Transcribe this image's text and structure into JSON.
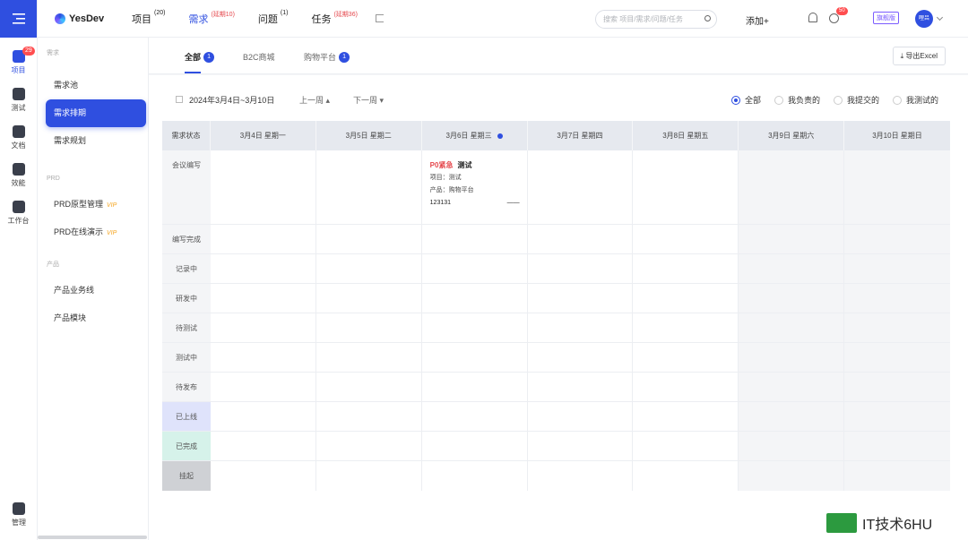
{
  "rail": {
    "items": [
      {
        "label": "项目",
        "badge": "29",
        "icon": "project-icon"
      },
      {
        "label": "测试",
        "icon": "test-icon"
      },
      {
        "label": "文档",
        "icon": "doc-icon"
      },
      {
        "label": "效能",
        "icon": "performance-icon"
      },
      {
        "label": "工作台",
        "icon": "workbench-icon"
      }
    ],
    "bottom_label": "管理"
  },
  "topbar": {
    "logo": "YesDev",
    "nav": [
      {
        "label": "项目",
        "count": "(20)",
        "count_red": false
      },
      {
        "label": "需求",
        "count": "(延期10)",
        "count_red": true
      },
      {
        "label": "问题",
        "count": "(1)",
        "count_red": false
      },
      {
        "label": "任务",
        "count": "(延期36)",
        "count_red": true
      }
    ],
    "search_placeholder": "搜索 项目/需求/问题/任务",
    "add_label": "添加+",
    "clock_badge": "50",
    "edition": "旗舰版",
    "avatar_text": "哩吕"
  },
  "sidebar": {
    "group1": "需求",
    "items1": [
      "需求池",
      "需求排期",
      "需求规划"
    ],
    "group2": "PRD",
    "items2": [
      "PRD原型管理",
      "PRD在线演示"
    ],
    "vip": "VIP",
    "group3": "产品",
    "items3": [
      "产品业务线",
      "产品模块"
    ]
  },
  "tabs": [
    {
      "label": "全部",
      "num": "1"
    },
    {
      "label": "B2C商城",
      "num": ""
    },
    {
      "label": "购物平台",
      "num": "1"
    }
  ],
  "export_label": "导出Excel",
  "toolbar": {
    "date_range": "2024年3月4日~3月10日",
    "prev_week": "上一周",
    "next_week": "下一周",
    "filters": [
      "全部",
      "我负责的",
      "我提交的",
      "我测试的"
    ]
  },
  "grid": {
    "first_header": "需求状态",
    "days": [
      "3月4日 星期一",
      "3月5日 星期二",
      "3月6日 星期三",
      "3月7日 星期四",
      "3月8日 星期五",
      "3月9日 星期六",
      "3月10日 星期日"
    ],
    "statuses": [
      "会议编写",
      "编写完成",
      "记录中",
      "研发中",
      "待测试",
      "测试中",
      "待发布",
      "已上线",
      "已完成",
      "挂起"
    ]
  },
  "card": {
    "priority": "P0紧急",
    "title": "测试",
    "project": "项目：测试",
    "product": "产品：购物平台",
    "code": "123131",
    "dash": "——"
  },
  "watermark": "IT技术6HU"
}
